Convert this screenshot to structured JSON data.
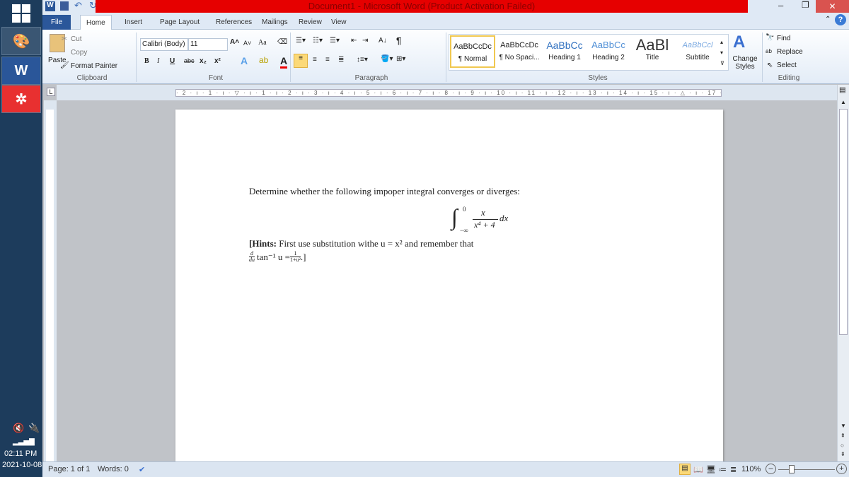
{
  "window": {
    "title": "Document1 - Microsoft Word (Product Activation Failed)"
  },
  "quick_access": {
    "icons": [
      "word-icon",
      "save-icon",
      "undo-icon",
      "redo-icon",
      "customize-icon"
    ]
  },
  "tabs": [
    {
      "label": "File"
    },
    {
      "label": "Home"
    },
    {
      "label": "Insert"
    },
    {
      "label": "Page Layout"
    },
    {
      "label": "References"
    },
    {
      "label": "Mailings"
    },
    {
      "label": "Review"
    },
    {
      "label": "View"
    }
  ],
  "clipboard": {
    "paste": "Paste",
    "cut": "Cut",
    "copy": "Copy",
    "format_painter": "Format Painter",
    "label": "Clipboard"
  },
  "font": {
    "name": "Calibri (Body)",
    "size": "11",
    "label": "Font",
    "case": "Aa",
    "bold": "B",
    "italic": "I",
    "underline": "U",
    "strike": "abc",
    "sub": "x₂",
    "sup": "x²"
  },
  "paragraph": {
    "label": "Paragraph",
    "pilcrow": "¶"
  },
  "styles": {
    "label": "Styles",
    "items": [
      {
        "sample": "AaBbCcDc",
        "name": "¶ Normal"
      },
      {
        "sample": "AaBbCcDc",
        "name": "¶ No Spaci..."
      },
      {
        "sample": "AaBbCc",
        "name": "Heading 1"
      },
      {
        "sample": "AaBbCc",
        "name": "Heading 2"
      },
      {
        "sample": "AaBl",
        "name": "Title"
      },
      {
        "sample": "AaBbCcl",
        "name": "Subtitle"
      }
    ],
    "change": "Change Styles"
  },
  "editing": {
    "label": "Editing",
    "find": "Find",
    "replace": "Replace",
    "select": "Select"
  },
  "ruler": {
    "marks": "· 2 · ı · 1 · ı · ▽ · ı · 1 · ı · 2 · ı · 3 · ı · 4 · ı · 5 · ı · 6 · ı · 7 · ı · 8 · ı · 9 · ı · 10 · ı · 11 · ı · 12 · ı · 13 · ı · 14 · ı · 15 · ı · △ · ı · 17 · ı · 18 ·"
  },
  "document": {
    "line1": "Determine whether the following impoper integral converges or diverges:",
    "integral": {
      "upper": "0",
      "lower": "−∞",
      "num": "x",
      "den": "x⁴ + 4",
      "dx": "dx"
    },
    "hint_bold": "[Hints:",
    "hint_text": " First use substitution withe u = x² and remember that",
    "hint2": "tan⁻¹ u = ",
    "hint2_frac_num": "1",
    "hint2_frac_den": "1+u²",
    "hint2_end": ".]",
    "deriv_num": "d",
    "deriv_den": "du"
  },
  "status": {
    "page": "Page: 1 of 1",
    "words": "Words: 0",
    "zoom": "110%",
    "zoom_level": 110
  },
  "system": {
    "time": "02:11 PM",
    "date": "2021-10-08"
  }
}
